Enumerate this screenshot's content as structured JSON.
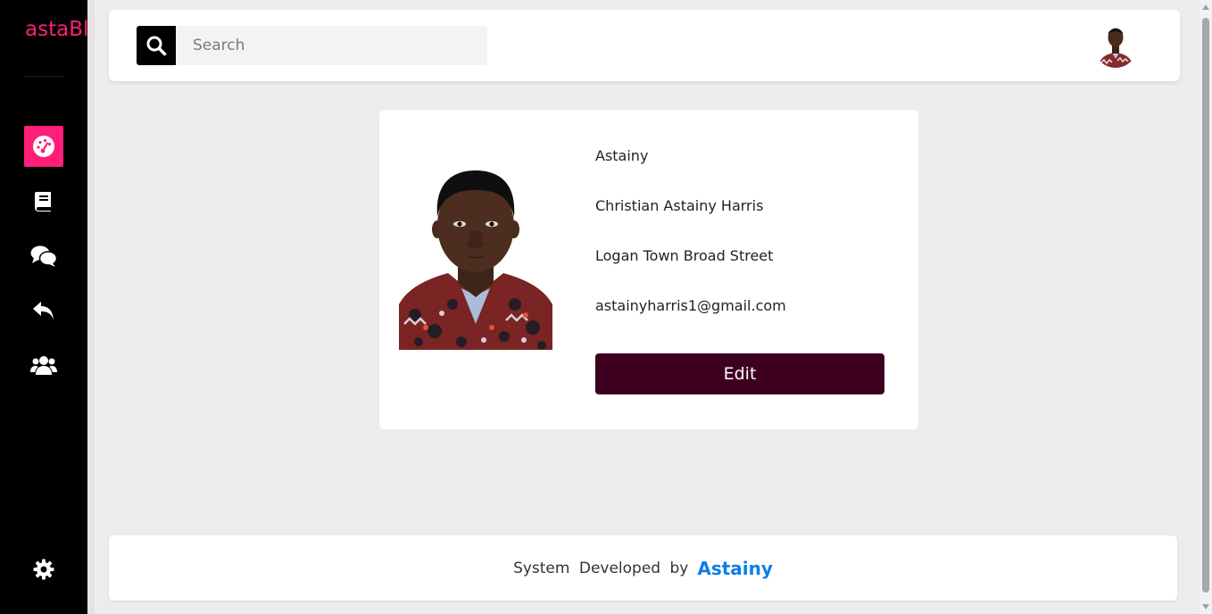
{
  "brand": {
    "name": "astaBl",
    "color": "#ff1f7a"
  },
  "sidebar": {
    "items": [
      {
        "icon": "dashboard-icon",
        "active": true
      },
      {
        "icon": "book-icon",
        "active": false
      },
      {
        "icon": "comments-icon",
        "active": false
      },
      {
        "icon": "reply-icon",
        "active": false
      },
      {
        "icon": "users-icon",
        "active": false
      }
    ],
    "bottom_icon": "gear-icon"
  },
  "search": {
    "placeholder": "Search",
    "value": ""
  },
  "profile": {
    "username": "Astainy",
    "full_name": "Christian Astainy Harris",
    "address": "Logan Town Broad Street",
    "email": "astainyharris1@gmail.com",
    "edit_label": "Edit"
  },
  "footer": {
    "text": "System Developed by",
    "author": "Astainy"
  },
  "colors": {
    "accent": "#ff1f7a",
    "edit_button": "#3d0020",
    "author_link": "#0d7dea"
  }
}
